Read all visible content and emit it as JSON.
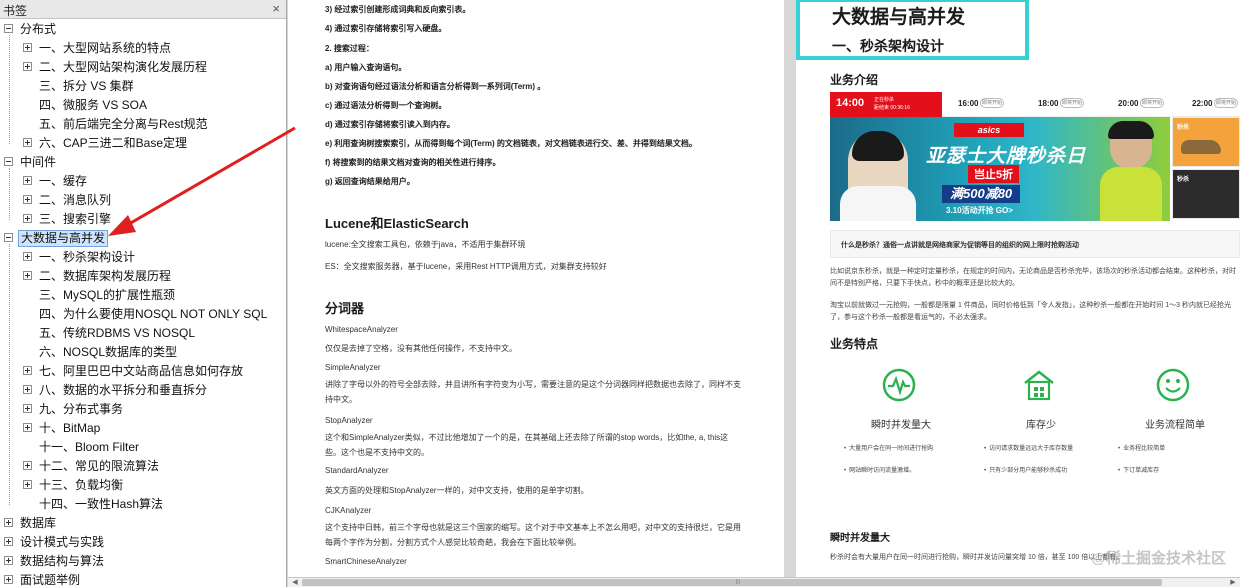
{
  "bookmarks": {
    "title": "书签",
    "close": "×",
    "items": [
      {
        "label": "分布式",
        "level": 0,
        "toggle": "minus"
      },
      {
        "label": "一、大型网站系统的特点",
        "level": 1,
        "toggle": "plus"
      },
      {
        "label": "二、大型网站架构演化发展历程",
        "level": 1,
        "toggle": "plus"
      },
      {
        "label": "三、拆分 VS 集群",
        "level": 1,
        "toggle": "none"
      },
      {
        "label": "四、微服务 VS SOA",
        "level": 1,
        "toggle": "none"
      },
      {
        "label": "五、前后端完全分离与Rest规范",
        "level": 1,
        "toggle": "none"
      },
      {
        "label": "六、CAP三进二和Base定理",
        "level": 1,
        "toggle": "plus"
      },
      {
        "label": "中间件",
        "level": 0,
        "toggle": "minus"
      },
      {
        "label": "一、缓存",
        "level": 1,
        "toggle": "plus"
      },
      {
        "label": "二、消息队列",
        "level": 1,
        "toggle": "plus"
      },
      {
        "label": "三、搜索引擎",
        "level": 1,
        "toggle": "plus"
      },
      {
        "label": "大数据与高并发",
        "level": 0,
        "toggle": "minus",
        "selected": true
      },
      {
        "label": "一、秒杀架构设计",
        "level": 1,
        "toggle": "plus"
      },
      {
        "label": "二、数据库架构发展历程",
        "level": 1,
        "toggle": "plus"
      },
      {
        "label": "三、MySQL的扩展性瓶颈",
        "level": 1,
        "toggle": "none"
      },
      {
        "label": "四、为什么要使用NOSQL NOT ONLY SQL",
        "level": 1,
        "toggle": "none"
      },
      {
        "label": "五、传统RDBMS VS NOSQL",
        "level": 1,
        "toggle": "none"
      },
      {
        "label": "六、NOSQL数据库的类型",
        "level": 1,
        "toggle": "none"
      },
      {
        "label": "七、阿里巴巴中文站商品信息如何存放",
        "level": 1,
        "toggle": "plus"
      },
      {
        "label": "八、数据的水平拆分和垂直拆分",
        "level": 1,
        "toggle": "plus"
      },
      {
        "label": "九、分布式事务",
        "level": 1,
        "toggle": "plus"
      },
      {
        "label": "十、BitMap",
        "level": 1,
        "toggle": "plus"
      },
      {
        "label": "十一、Bloom Filter",
        "level": 1,
        "toggle": "none"
      },
      {
        "label": "十二、常见的限流算法",
        "level": 1,
        "toggle": "plus"
      },
      {
        "label": "十三、负载均衡",
        "level": 1,
        "toggle": "plus"
      },
      {
        "label": "十四、一致性Hash算法",
        "level": 1,
        "toggle": "none"
      },
      {
        "label": "数据库",
        "level": 0,
        "toggle": "plus"
      },
      {
        "label": "设计模式与实践",
        "level": 0,
        "toggle": "plus"
      },
      {
        "label": "数据结构与算法",
        "level": 0,
        "toggle": "plus"
      },
      {
        "label": "面试题举例",
        "level": 0,
        "toggle": "plus"
      }
    ]
  },
  "left_page": {
    "steps1": [
      "3) 经过索引创建形成词典和反向索引表。",
      "4) 通过索引存储将索引写入硬盘。"
    ],
    "search_title": "2. 搜索过程：",
    "steps2": [
      "a) 用户输入查询语句。",
      "b) 对查询语句经过语法分析和语言分析得到一系列词(Term) 。",
      "c) 通过语法分析得到一个查询树。",
      "d) 通过索引存储将索引读入到内存。",
      "e) 利用查询树搜索索引，从而得到每个词(Term) 的文档链表，对文档链表进行交、差、并得到结果文档。",
      "f) 将搜索到的结果文档对查询的相关性进行排序。",
      "g) 返回查询结果给用户。"
    ],
    "lucene_title": "Lucene和ElasticSearch",
    "lucene_line": "lucene:全文搜索工具包，依赖于java，不适用于集群环境",
    "es_line": "ES：全文搜索服务器，基于lucene，采用Rest HTTP调用方式，对集群支持较好",
    "analyzer_title": "分词器",
    "analyzers": [
      {
        "name": "WhitespaceAnalyzer",
        "desc": "仅仅是去掉了空格，没有其他任何操作，不支持中文。"
      },
      {
        "name": "SimpleAnalyzer",
        "desc": "讲除了字母以外的符号全部去除，并且讲所有字符变为小写，需要注意的是这个分词器同样把数据也去除了，同样不支持中文。"
      },
      {
        "name": "StopAnalyzer",
        "desc": "这个和SimpleAnalyzer类似，不过比他增加了一个的是，在其基础上还去除了所谓的stop words，比如the, a, this这些。这个也是不支持中文的。"
      },
      {
        "name": "StandardAnalyzer",
        "desc": "英文方面的处理和StopAnalyzer一样的，对中文支持，使用的是单字切割。"
      },
      {
        "name": "CJKAnalyzer",
        "desc": "这个支持中日韩，前三个字母也就是这三个国家的缩写。这个对于中文基本上不怎么用吧，对中文的支持很烂，它是用每两个字作为分割，分割方式个人感觉比较奇葩，我会在下面比较举例。"
      },
      {
        "name": "SmartChineseAnalyzer",
        "desc": ""
      }
    ]
  },
  "right_page": {
    "h1": "大数据与高并发",
    "h2": "一、秒杀架构设计",
    "biz_intro": "业务介绍",
    "timebar": {
      "active_time": "14:00",
      "active_line1": "正在秒杀",
      "active_line2": "距结束 00:36:16",
      "slots": [
        "16:00",
        "18:00",
        "20:00",
        "22:00"
      ],
      "slot_badge": "即将开始"
    },
    "banner": {
      "brand": "asics",
      "title": "亚瑟士大牌秒杀日",
      "sub": "岂止5折",
      "deal": "满500减80",
      "date": "3.10活动开抢 GO>",
      "side1": "秒杀",
      "side2": "秒杀"
    },
    "qa": "什么是秒杀？通俗一点讲就是网络商家为促销等目的组织的网上限时抢购活动",
    "intro_p1": "比如说京东秒杀，就是一种定时定量秒杀，在规定的时间内，无论商品是否秒杀完毕，该场次的秒杀活动都会结束。这种秒杀，对时间不是特别严格，只要下手快点，秒中的概率还是比较大的。",
    "intro_p2": "淘宝以前就做过一元抢购，一般都是限量 1 件商品，同时价格低到「令人发指」，这种秒杀一般都在开始时间 1～3 秒内就已经抢光了，参与这个秒杀一般都是看运气的，不必太强求。",
    "features_title": "业务特点",
    "features": [
      {
        "title": "瞬时并发量大",
        "icon": "pulse-icon",
        "bullets": [
          "大量用户会在同一时间进行抢购",
          "网站瞬时访问流量激增。"
        ]
      },
      {
        "title": "库存少",
        "icon": "warehouse-icon",
        "bullets": [
          "访问请求数量远远大于库存数量",
          "只有少部分用户能够秒杀成功"
        ]
      },
      {
        "title": "业务流程简单",
        "icon": "smile-icon",
        "bullets": [
          "业务程比较简单",
          "下订单减库存"
        ]
      }
    ],
    "burst_title": "瞬时并发量大",
    "burst_p": "秒杀时会有大量用户在同一时间进行抢购，瞬时并发访问量突增 10 倍，甚至 100 倍以上都有。",
    "watermark": "@稀土掘金技术社区"
  },
  "colors": {
    "highlight_box": "#34d1d5",
    "arrow": "#e02020",
    "accent_green": "#2bb24c",
    "banner_red": "#e3101b"
  }
}
